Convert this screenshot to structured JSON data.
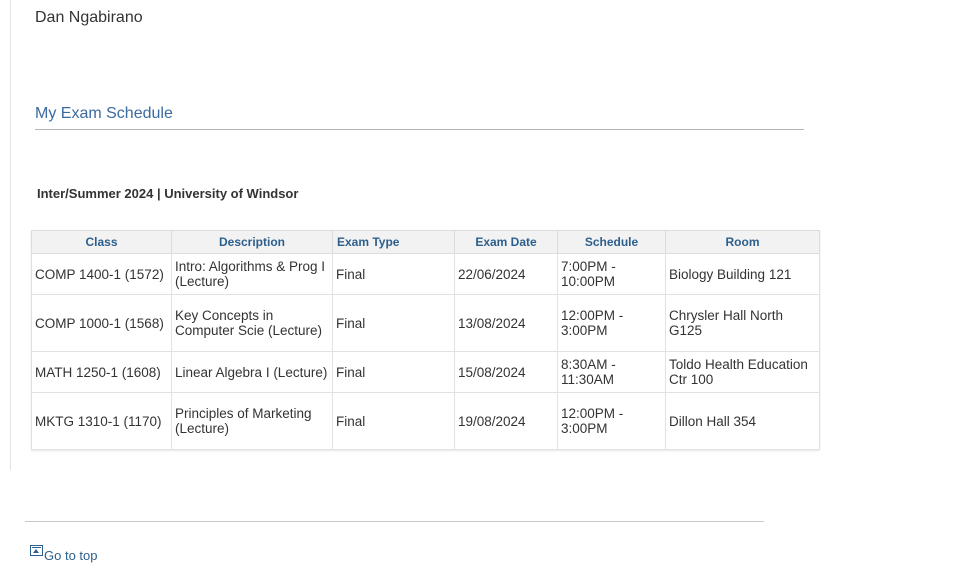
{
  "user": {
    "name": "Dan Ngabirano"
  },
  "page": {
    "title": "My Exam Schedule"
  },
  "term": {
    "heading": "Inter/Summer 2024 | University of Windsor"
  },
  "table": {
    "headers": [
      "Class",
      "Description",
      "Exam Type",
      "Exam Date",
      "Schedule",
      "Room"
    ],
    "rows": [
      {
        "class": "COMP 1400-1 (1572)",
        "description": "Intro: Algorithms & Prog I (Lecture)",
        "exam_type": "Final",
        "exam_date": "22/06/2024",
        "schedule": "7:00PM - 10:00PM",
        "room": "Biology Building 121"
      },
      {
        "class": "COMP 1000-1 (1568)",
        "description": "Key Concepts in Computer Scie (Lecture)",
        "exam_type": "Final",
        "exam_date": "13/08/2024",
        "schedule": "12:00PM - 3:00PM",
        "room": "Chrysler Hall North G125"
      },
      {
        "class": "MATH 1250-1 (1608)",
        "description": "Linear Algebra I (Lecture)",
        "exam_type": "Final",
        "exam_date": "15/08/2024",
        "schedule": "8:30AM - 11:30AM",
        "room": "Toldo Health Education Ctr 100"
      },
      {
        "class": "MKTG 1310-1 (1170)",
        "description": "Principles of Marketing (Lecture)",
        "exam_type": "Final",
        "exam_date": "19/08/2024",
        "schedule": "12:00PM - 3:00PM",
        "room": "Dillon Hall 354"
      }
    ]
  },
  "footer": {
    "go_to_top_label": "Go to top",
    "go_to_top_icon": "arrow-up-to-top-icon"
  }
}
